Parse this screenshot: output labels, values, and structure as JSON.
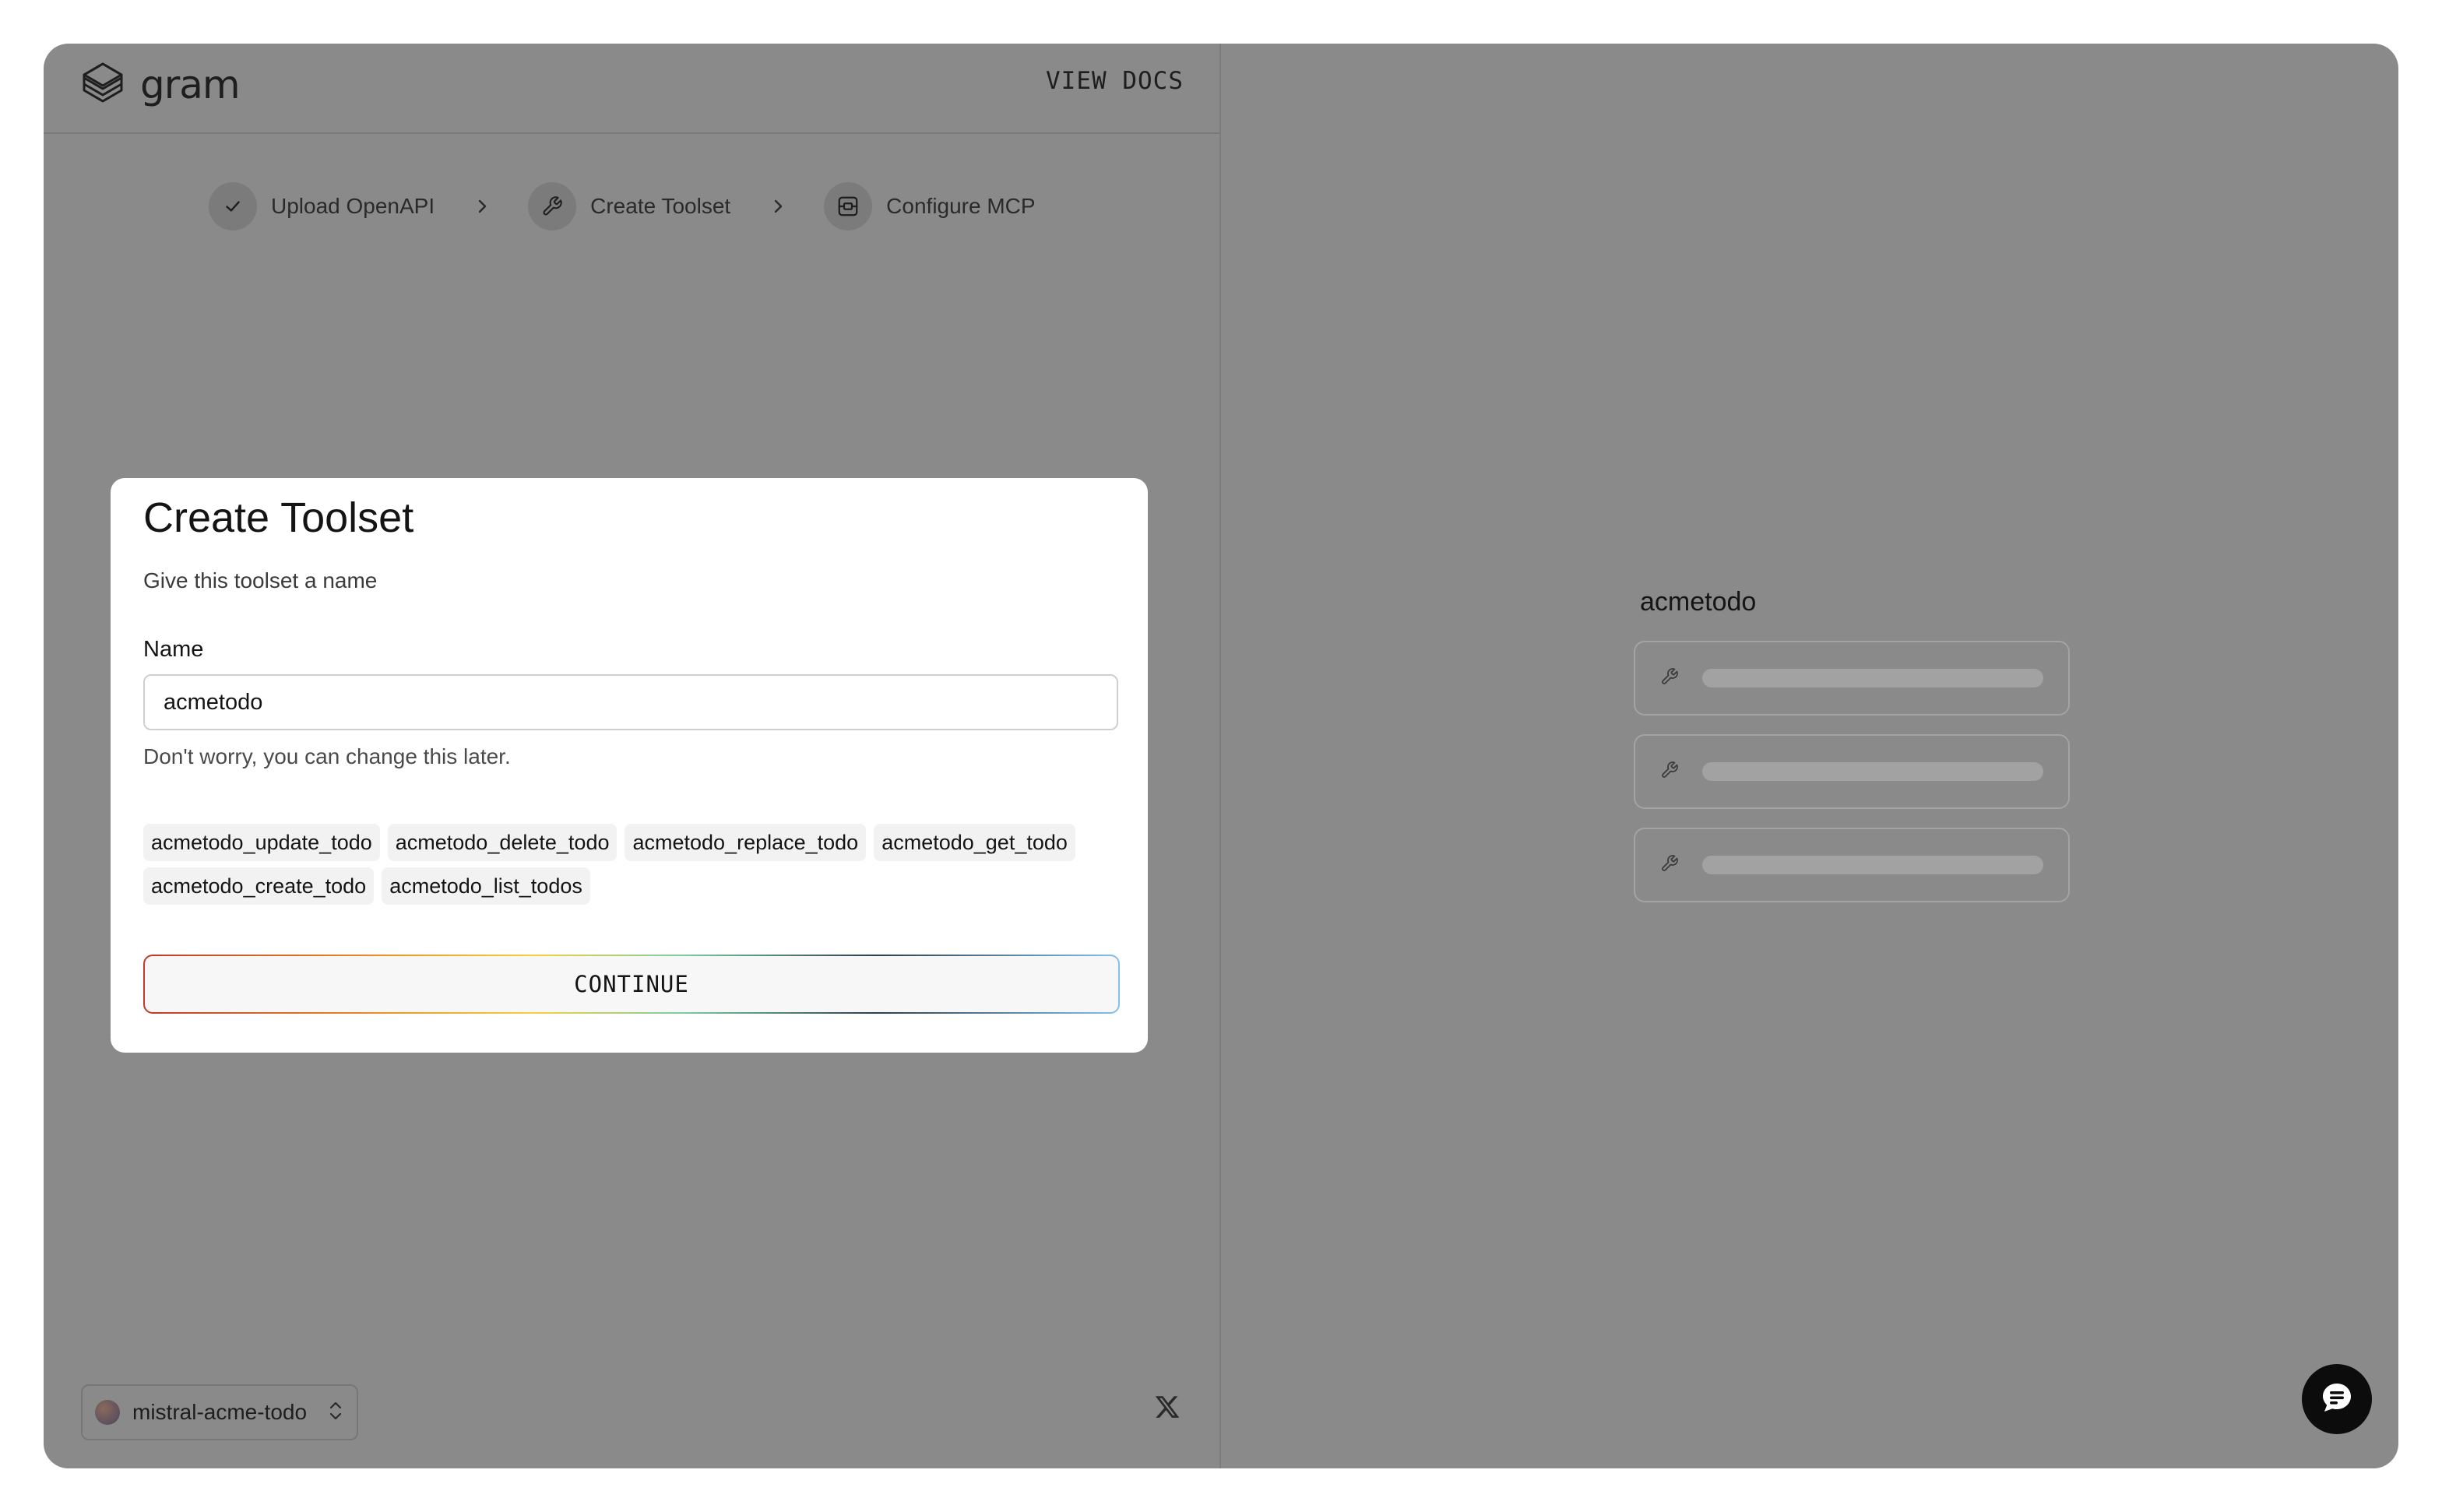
{
  "app": {
    "logo_text": "gram",
    "view_docs_label": "VIEW DOCS"
  },
  "stepper": {
    "steps": [
      {
        "label": "Upload OpenAPI",
        "icon": "check-icon",
        "state": "complete"
      },
      {
        "label": "Create Toolset",
        "icon": "wrench-icon",
        "state": "current"
      },
      {
        "label": "Configure MCP",
        "icon": "mcp-server-icon",
        "state": "upcoming"
      }
    ]
  },
  "card": {
    "title": "Create Toolset",
    "subtitle": "Give this toolset a name",
    "name_label": "Name",
    "name_value": "acmetodo",
    "helper_text": "Don't worry, you can change this later.",
    "tools": [
      "acmetodo_update_todo",
      "acmetodo_delete_todo",
      "acmetodo_replace_todo",
      "acmetodo_get_todo",
      "acmetodo_create_todo",
      "acmetodo_list_todos"
    ],
    "continue_label": "CONTINUE"
  },
  "footer": {
    "project_name": "mistral-acme-todo",
    "social_icon": "x-logo-icon"
  },
  "preview": {
    "toolset_name": "acmetodo",
    "placeholder_rows": 3
  },
  "colors": {
    "overlay": "#8a8a8a",
    "card_bg": "#ffffff",
    "tag_bg": "#f2f2f2",
    "chat_button_bg": "#0c0c0c"
  }
}
